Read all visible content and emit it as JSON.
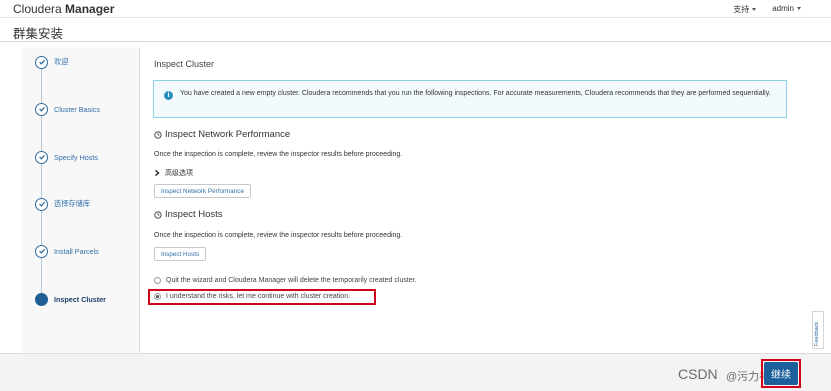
{
  "app": {
    "brand_light": "Cloudera",
    "brand_bold": "Manager",
    "support_label": "支持",
    "user_label": "admin"
  },
  "page": {
    "title": "群集安装"
  },
  "sidebar": {
    "steps": [
      {
        "label": "欢迎",
        "state": "done"
      },
      {
        "label": "Cluster Basics",
        "state": "done"
      },
      {
        "label": "Specify Hosts",
        "state": "done"
      },
      {
        "label": "选择存储库",
        "state": "done"
      },
      {
        "label": "Install Parcels",
        "state": "done"
      },
      {
        "label": "Inspect Cluster",
        "state": "current"
      }
    ]
  },
  "main": {
    "section_title": "Inspect Cluster",
    "info_alert": "You have created a new empty cluster. Cloudera recommends that you run the following inspections. For accurate measurements, Cloudera recommends that they are performed sequentially.",
    "network": {
      "heading": "Inspect Network Performance",
      "description": "Once the inspection is complete, review the inspector results before proceeding.",
      "advanced_label": "高级选项",
      "button_label": "Inspect Network Performance"
    },
    "hosts": {
      "heading": "Inspect Hosts",
      "description": "Once the inspection is complete, review the inspector results before proceeding.",
      "button_label": "Inspect Hosts"
    },
    "options": [
      {
        "label": "Quit the wizard and Cloudera Manager will delete the temporarily created cluster.",
        "checked": false
      },
      {
        "label": "I understand the risks, let me continue with cluster creation.",
        "checked": true
      }
    ]
  },
  "feedback_label": "Feedback",
  "footer": {
    "next_label": "继续",
    "watermark": "CSDN",
    "watermark_at": "@",
    "watermark_user": "污力神祖"
  },
  "colors": {
    "accent": "#1d5f9a",
    "highlight": "#d0021b",
    "info_border": "#8fd1ea"
  }
}
